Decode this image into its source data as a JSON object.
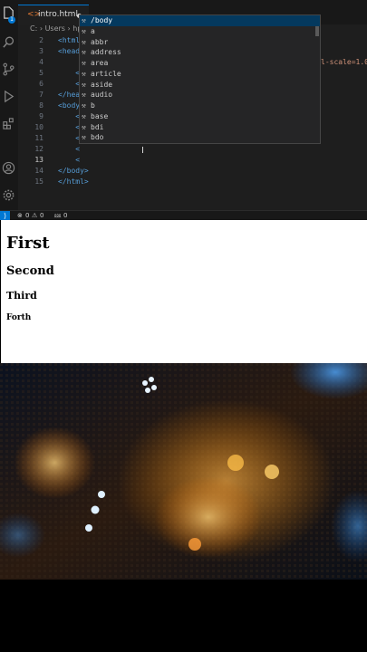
{
  "editor": {
    "tab": {
      "filename": "intro.html",
      "icon": "html-file-icon"
    },
    "breadcrumb": {
      "text": "C: › Users › hp"
    },
    "line_numbers": [
      "2",
      "3",
      "4",
      "5",
      "6",
      "7",
      "8",
      "9",
      "10",
      "11",
      "12",
      "13",
      "14",
      "15"
    ],
    "active_line": "13",
    "code_lines": [
      {
        "indent": "",
        "text": "<html"
      },
      {
        "indent": "",
        "text": "<head"
      },
      {
        "indent": "    ",
        "text": ""
      },
      {
        "indent": "    ",
        "text": "<"
      },
      {
        "indent": "    ",
        "text": "<"
      },
      {
        "indent": "",
        "text": "</hea"
      },
      {
        "indent": "",
        "text": "<body"
      },
      {
        "indent": "    ",
        "text": "<"
      },
      {
        "indent": "    ",
        "text": "<"
      },
      {
        "indent": "    ",
        "text": "<"
      },
      {
        "indent": "    ",
        "text": "<"
      },
      {
        "indent": "    ",
        "text": "<"
      },
      {
        "indent": "",
        "text": "</body>"
      },
      {
        "indent": "",
        "text": "</html>"
      }
    ],
    "code_right_fragment": "l-scale=1.0",
    "suggestions": [
      "/body",
      "a",
      "abbr",
      "address",
      "area",
      "article",
      "aside",
      "audio",
      "b",
      "base",
      "bdi",
      "bdo"
    ],
    "selected_suggestion": "/body",
    "suggestion_icon": "wrench-icon"
  },
  "status_bar": {
    "errors": "0",
    "warnings": "0",
    "ports": "0"
  },
  "preview": {
    "h1": "First",
    "h2": "Second",
    "h3": "Third",
    "h4": "Forth"
  },
  "colors": {
    "editor_bg": "#1e1e1e",
    "accent": "#0078d4",
    "tag": "#569cd6",
    "selection": "#04395e"
  }
}
